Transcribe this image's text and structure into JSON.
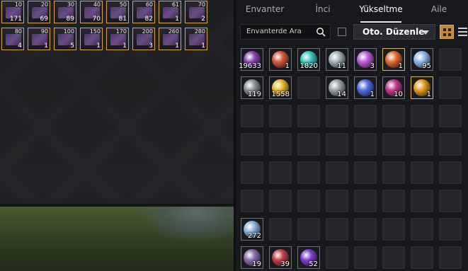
{
  "tabs": [
    "Envanter",
    "İnci",
    "Yükseltme",
    "Aile"
  ],
  "active_tab": 2,
  "search": {
    "placeholder": "Envanterde Ara"
  },
  "sort": {
    "label": "Oto. Düzenle"
  },
  "left_items": [
    [
      {
        "level": "10",
        "count": "171"
      },
      {
        "level": "20",
        "count": "69"
      },
      {
        "level": "30",
        "count": "89"
      },
      {
        "level": "40",
        "count": "70"
      },
      {
        "level": "50",
        "count": "81"
      },
      {
        "level": "60",
        "count": "82"
      },
      {
        "level": "61",
        "count": "1"
      },
      {
        "level": "70",
        "count": "2"
      }
    ],
    [
      {
        "level": "80",
        "count": "4"
      },
      {
        "level": "90",
        "count": "1"
      },
      {
        "level": "100",
        "count": "5"
      },
      {
        "level": "150",
        "count": "1"
      },
      {
        "level": "170",
        "count": "1"
      },
      {
        "level": "200",
        "count": "3"
      },
      {
        "level": "260",
        "count": "1"
      },
      {
        "level": "280",
        "count": "1"
      }
    ]
  ],
  "inventory": [
    [
      {
        "count": "19633",
        "color": "#8a3fb0",
        "border": "grey"
      },
      {
        "count": "1",
        "color": "#d2553a",
        "border": "grey"
      },
      {
        "count": "1820",
        "color": "#3bc6c0",
        "border": "grey"
      },
      {
        "count": "11",
        "color": "#9fb0b8",
        "border": "grey"
      },
      {
        "count": "3",
        "color": "#c05ad8",
        "border": "grey"
      },
      {
        "count": "1",
        "color": "#e06a2c",
        "border": "gold"
      },
      {
        "count": "95",
        "color": "#8fb8e6",
        "border": "grey"
      },
      null
    ],
    [
      {
        "count": "119",
        "color": "#8a8f96",
        "border": "grey"
      },
      {
        "count": "1558",
        "color": "#e8b62a",
        "border": "grey"
      },
      null,
      {
        "count": "14",
        "color": "#9aa0a8",
        "border": "grey"
      },
      {
        "count": "1",
        "color": "#4d6de0",
        "border": "grey"
      },
      {
        "count": "10",
        "color": "#c0398c",
        "border": "grey"
      },
      {
        "count": "1",
        "color": "#e09a22",
        "border": "gold"
      },
      null
    ],
    [
      null,
      null,
      null,
      null,
      null,
      null,
      null,
      null
    ],
    [
      null,
      null,
      null,
      null,
      null,
      null,
      null,
      null
    ],
    [
      null,
      null,
      null,
      null,
      null,
      null,
      null,
      null
    ],
    [
      null,
      null,
      null,
      null,
      null,
      null,
      null,
      null
    ],
    [
      {
        "count": "272",
        "color": "#8ab0d8",
        "border": "grey"
      },
      null,
      null,
      null,
      null,
      null,
      null,
      null
    ],
    [
      {
        "count": "19",
        "color": "#8a6ab0",
        "border": "grey"
      },
      {
        "count": "39",
        "color": "#c0404a",
        "border": "grey"
      },
      {
        "count": "52",
        "color": "#7a3fc8",
        "border": "grey"
      },
      null,
      null,
      null,
      null,
      null
    ]
  ]
}
